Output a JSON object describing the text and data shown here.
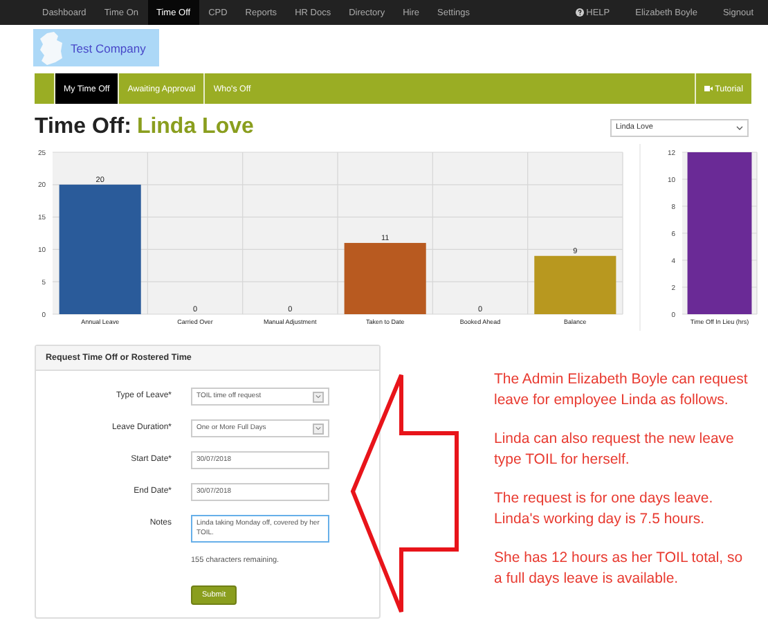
{
  "nav": {
    "items": [
      {
        "label": "Dashboard",
        "selected": false
      },
      {
        "label": "Time On",
        "selected": false
      },
      {
        "label": "Time Off",
        "selected": true
      },
      {
        "label": "CPD",
        "selected": false
      },
      {
        "label": "Reports",
        "selected": false
      },
      {
        "label": "HR Docs",
        "selected": false
      },
      {
        "label": "Directory",
        "selected": false
      },
      {
        "label": "Hire",
        "selected": false
      },
      {
        "label": "Settings",
        "selected": false
      }
    ],
    "help": "HELP",
    "user": "Elizabeth Boyle",
    "signout": "Signout"
  },
  "logo": {
    "company": "Test Company"
  },
  "tabs": [
    {
      "label": "My Time Off",
      "selected": true
    },
    {
      "label": "Awaiting Approval",
      "selected": false
    },
    {
      "label": "Who's Off",
      "selected": false
    }
  ],
  "tutorial": "Tutorial",
  "heading": {
    "label": "Time Off:",
    "name": "Linda Love"
  },
  "employee_select": {
    "value": "Linda Love"
  },
  "charts": [
    {
      "chart_data": {
        "type": "bar",
        "categories": [
          "Annual Leave",
          "Carried Over",
          "Manual Adjustment",
          "Taken to Date",
          "Booked Ahead",
          "Balance"
        ],
        "values": [
          20,
          0,
          0,
          11,
          0,
          9
        ],
        "colors": [
          "#2a5b9a",
          null,
          null,
          "#b85a20",
          null,
          "#b8981f"
        ],
        "grid": true,
        "ylim": [
          0,
          25
        ],
        "yticks": [
          0,
          5,
          10,
          15,
          20,
          25
        ],
        "data_labels": true
      }
    },
    {
      "chart_data": {
        "type": "bar",
        "categories": [
          "Time Off In Lieu (hrs)"
        ],
        "values": [
          12
        ],
        "colors": [
          "#6a2a96"
        ],
        "grid": true,
        "ylim": [
          0,
          12
        ],
        "yticks": [
          0,
          2,
          4,
          6,
          8,
          10,
          12
        ]
      }
    }
  ],
  "form": {
    "title": "Request Time Off or Rostered Time",
    "fields": [
      {
        "kind": "select",
        "label": "Type of Leave*",
        "value": "TOIL time off request"
      },
      {
        "kind": "select",
        "label": "Leave Duration*",
        "value": "One or More Full Days"
      },
      {
        "kind": "input",
        "label": "Start Date*",
        "value": "30/07/2018"
      },
      {
        "kind": "input",
        "label": "End Date*",
        "value": "30/07/2018"
      },
      {
        "kind": "textarea",
        "label": "Notes",
        "value": "Linda taking Monday off, covered by her TOIL."
      }
    ],
    "remaining": "155 characters remaining.",
    "submit": "Submit"
  },
  "annotation": [
    "The Admin Elizabeth Boyle can request leave for employee Linda as follows.",
    "Linda can also request the new leave type TOIL for herself.",
    "The request is for one days leave. Linda's working day is 7.5 hours.",
    "She has 12 hours as her TOIL total, so a full days leave is available."
  ]
}
